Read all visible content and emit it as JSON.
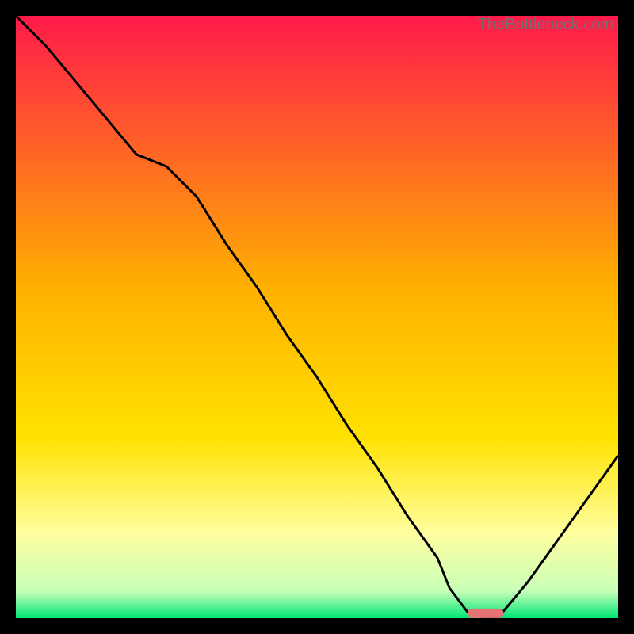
{
  "watermark": "TheBottleneck.com",
  "colors": {
    "top": "#ff1a4b",
    "mid": "#ffd500",
    "pale": "#ffffa0",
    "bottom": "#00e676",
    "curve": "#000000",
    "marker": "#e57373",
    "frame": "#000000"
  },
  "chart_data": {
    "type": "line",
    "title": "",
    "xlabel": "",
    "ylabel": "",
    "xlim": [
      0,
      100
    ],
    "ylim": [
      0,
      100
    ],
    "x": [
      0,
      5,
      10,
      15,
      20,
      25,
      30,
      35,
      40,
      45,
      50,
      55,
      60,
      65,
      70,
      72,
      75,
      78,
      80,
      85,
      90,
      95,
      100
    ],
    "y": [
      100,
      95,
      89,
      83,
      77,
      75,
      70,
      62,
      55,
      47,
      40,
      32,
      25,
      17,
      10,
      5,
      1,
      0,
      0,
      6,
      13,
      20,
      27
    ],
    "marker": {
      "x0": 75,
      "x1": 81,
      "y": 0.8
    },
    "gradient_stops": [
      {
        "offset": 0.0,
        "color": "#ff1a4b"
      },
      {
        "offset": 0.45,
        "color": "#ffb000"
      },
      {
        "offset": 0.7,
        "color": "#ffe200"
      },
      {
        "offset": 0.86,
        "color": "#ffffa0"
      },
      {
        "offset": 0.955,
        "color": "#c8ffb8"
      },
      {
        "offset": 1.0,
        "color": "#00e676"
      }
    ]
  }
}
